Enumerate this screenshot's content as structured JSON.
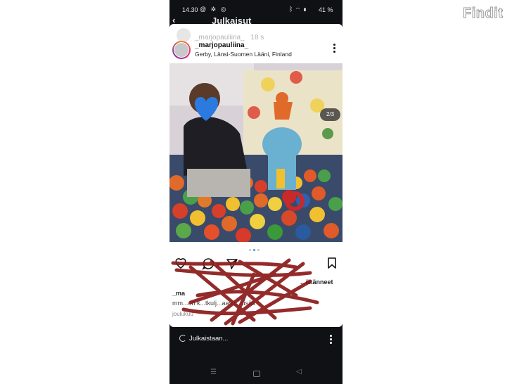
{
  "status_bar": {
    "time": "14.30",
    "battery": "41 %"
  },
  "header": {
    "title": "Julkaisut"
  },
  "post": {
    "username": "_marjopauliina_",
    "ghost_username": "_marjopauliina_",
    "ghost_time": "18 s",
    "location": "Gerby, Länsi-Suomen Lääni, Finland",
    "photo_counter": "2/3",
    "comment_count": "2",
    "likes_text": "...äkänneet",
    "caption_username": "_ma",
    "caption_text": "mm...eri k...tkulj...aasti... lisää",
    "caption_more": "joulukuu"
  },
  "bottom_bar": {
    "status_text": "Julkaistaan..."
  },
  "navbar": {
    "recent_glyph": "☰",
    "back_glyph": "◁"
  },
  "brand": {
    "logo_text": "Findit"
  },
  "colors": {
    "brand_annotation": "#8b1a1a",
    "phone_bg": "#0f1114"
  }
}
